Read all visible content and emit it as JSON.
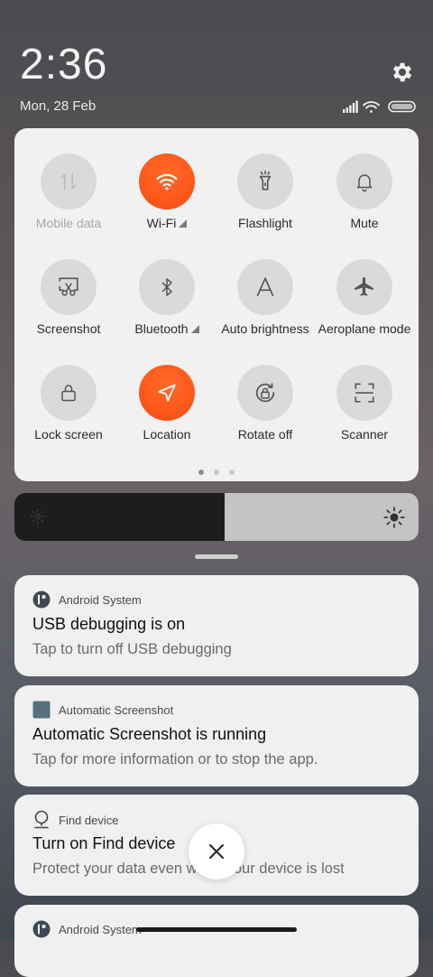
{
  "status": {
    "time": "2:36",
    "date": "Mon, 28 Feb"
  },
  "quick_settings": {
    "tiles": [
      {
        "label": "Mobile data",
        "icon": "mobile-data-icon",
        "active": false,
        "disabled": true
      },
      {
        "label": "Wi-Fi",
        "icon": "wifi-icon",
        "active": true,
        "expandable": true
      },
      {
        "label": "Flashlight",
        "icon": "flashlight-icon",
        "active": false
      },
      {
        "label": "Mute",
        "icon": "bell-icon",
        "active": false
      },
      {
        "label": "Screenshot",
        "icon": "screenshot-icon",
        "active": false
      },
      {
        "label": "Bluetooth",
        "icon": "bluetooth-icon",
        "active": false,
        "expandable": true
      },
      {
        "label": "Auto brightness",
        "icon": "auto-brightness-icon",
        "active": false
      },
      {
        "label": "Aeroplane mode",
        "icon": "airplane-icon",
        "active": false
      },
      {
        "label": "Lock screen",
        "icon": "lock-icon",
        "active": false
      },
      {
        "label": "Location",
        "icon": "location-icon",
        "active": true
      },
      {
        "label": "Rotate off",
        "icon": "rotate-lock-icon",
        "active": false
      },
      {
        "label": "Scanner",
        "icon": "scanner-icon",
        "active": false
      }
    ],
    "page_count": 3,
    "current_page": 1
  },
  "brightness": {
    "level": 0.52
  },
  "notifications": [
    {
      "app": "Android System",
      "app_icon": "android-system-icon",
      "title": "USB debugging is on",
      "body": "Tap to turn off USB debugging"
    },
    {
      "app": "Automatic Screenshot",
      "app_icon": "app-square-icon",
      "title": "Automatic Screenshot is running",
      "body": "Tap for more information or to stop the app."
    },
    {
      "app": "Find device",
      "app_icon": "find-device-icon",
      "title": "Turn on Find device",
      "body": "Protect your data even when your device is lost"
    },
    {
      "app": "Android System",
      "app_icon": "android-system-icon"
    }
  ],
  "colors": {
    "accent": "#ff5a1d",
    "panel_bg": "#f2f1f1",
    "tile_off": "#dadada"
  }
}
